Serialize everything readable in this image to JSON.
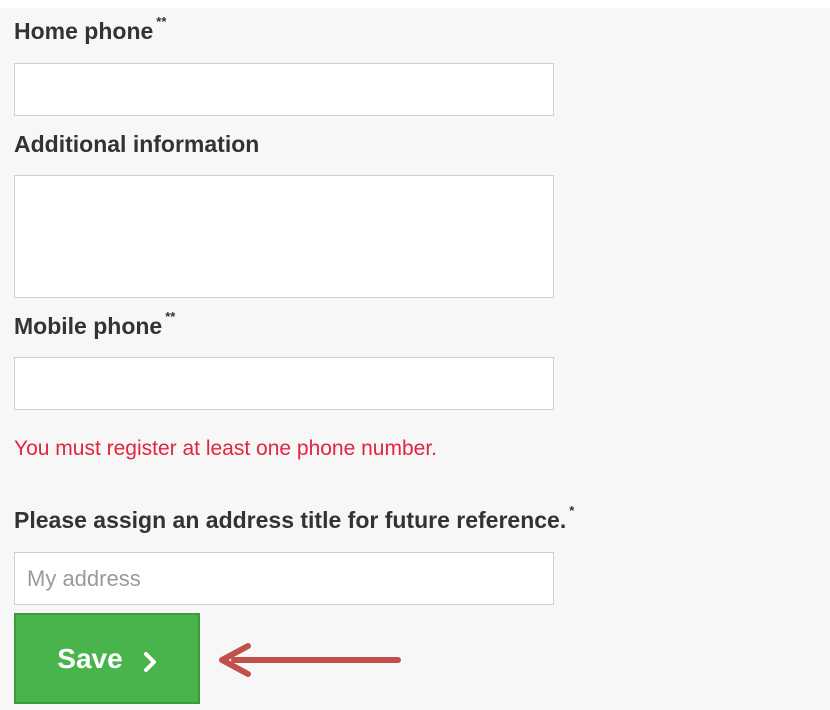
{
  "form": {
    "home_phone": {
      "label": "Home phone",
      "required_mark": "**",
      "value": ""
    },
    "additional_info": {
      "label": "Additional information",
      "value": ""
    },
    "mobile_phone": {
      "label": "Mobile phone",
      "required_mark": "**",
      "value": ""
    },
    "error_message": "You must register at least one phone number.",
    "address_title": {
      "label": "Please assign an address title for future reference.",
      "required_mark": "*",
      "placeholder": "My address",
      "value": ""
    },
    "save_button": {
      "label": "Save",
      "icon": "chevron-right-icon"
    }
  },
  "annotation": {
    "icon": "left-arrow-annotation",
    "color": "#c0504d"
  },
  "colors": {
    "button_green": "#49b34c",
    "error_red": "#e2253f",
    "label_text": "#333333"
  }
}
